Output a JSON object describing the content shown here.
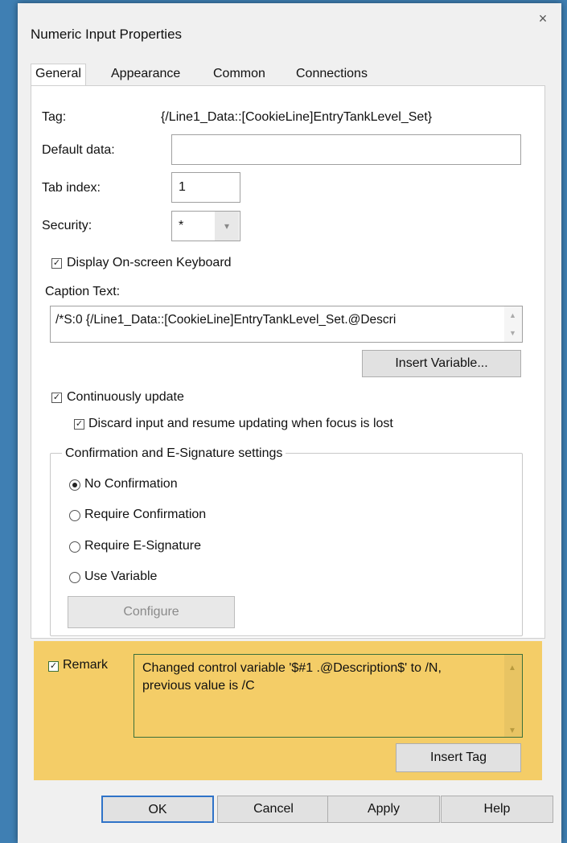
{
  "dialog": {
    "title": "Numeric Input Properties",
    "close_glyph": "×"
  },
  "tabs": [
    {
      "label": "General",
      "active": true
    },
    {
      "label": "Appearance",
      "active": false
    },
    {
      "label": "Common",
      "active": false
    },
    {
      "label": "Connections",
      "active": false
    }
  ],
  "general": {
    "tag_label": "Tag:",
    "tag_value": "{/Line1_Data::[CookieLine]EntryTankLevel_Set}",
    "default_data_label": "Default data:",
    "default_data_value": "",
    "tab_index_label": "Tab index:",
    "tab_index_value": "1",
    "security_label": "Security:",
    "security_value": "*",
    "display_keyboard_label": "Display On-screen Keyboard",
    "display_keyboard_checked": true,
    "caption_label": "Caption Text:",
    "caption_value": "/*S:0 {/Line1_Data::[CookieLine]EntryTankLevel_Set.@Descri",
    "insert_variable_label": "Insert Variable...",
    "continuously_update_label": "Continuously update",
    "continuously_update_checked": true,
    "discard_input_label": "Discard input and resume updating when focus is lost",
    "discard_input_checked": true
  },
  "confirmation": {
    "group_label": "Confirmation and E-Signature settings",
    "options": [
      {
        "label": "No Confirmation",
        "selected": true
      },
      {
        "label": "Require Confirmation",
        "selected": false
      },
      {
        "label": "Require E-Signature",
        "selected": false
      },
      {
        "label": "Use Variable",
        "selected": false
      }
    ],
    "configure_label": "Configure"
  },
  "remark": {
    "label": "Remark",
    "checked": true,
    "text": "Changed control variable '$#1 .@Description$' to /N, previous value is /C",
    "insert_tag_label": "Insert Tag",
    "highlight_color": "#f4cd67"
  },
  "footer": {
    "ok": "OK",
    "cancel": "Cancel",
    "apply": "Apply",
    "help": "Help"
  },
  "icons": {
    "check": "✓",
    "dropdown": "▾",
    "scroll_up": "▲",
    "scroll_down": "▼"
  }
}
